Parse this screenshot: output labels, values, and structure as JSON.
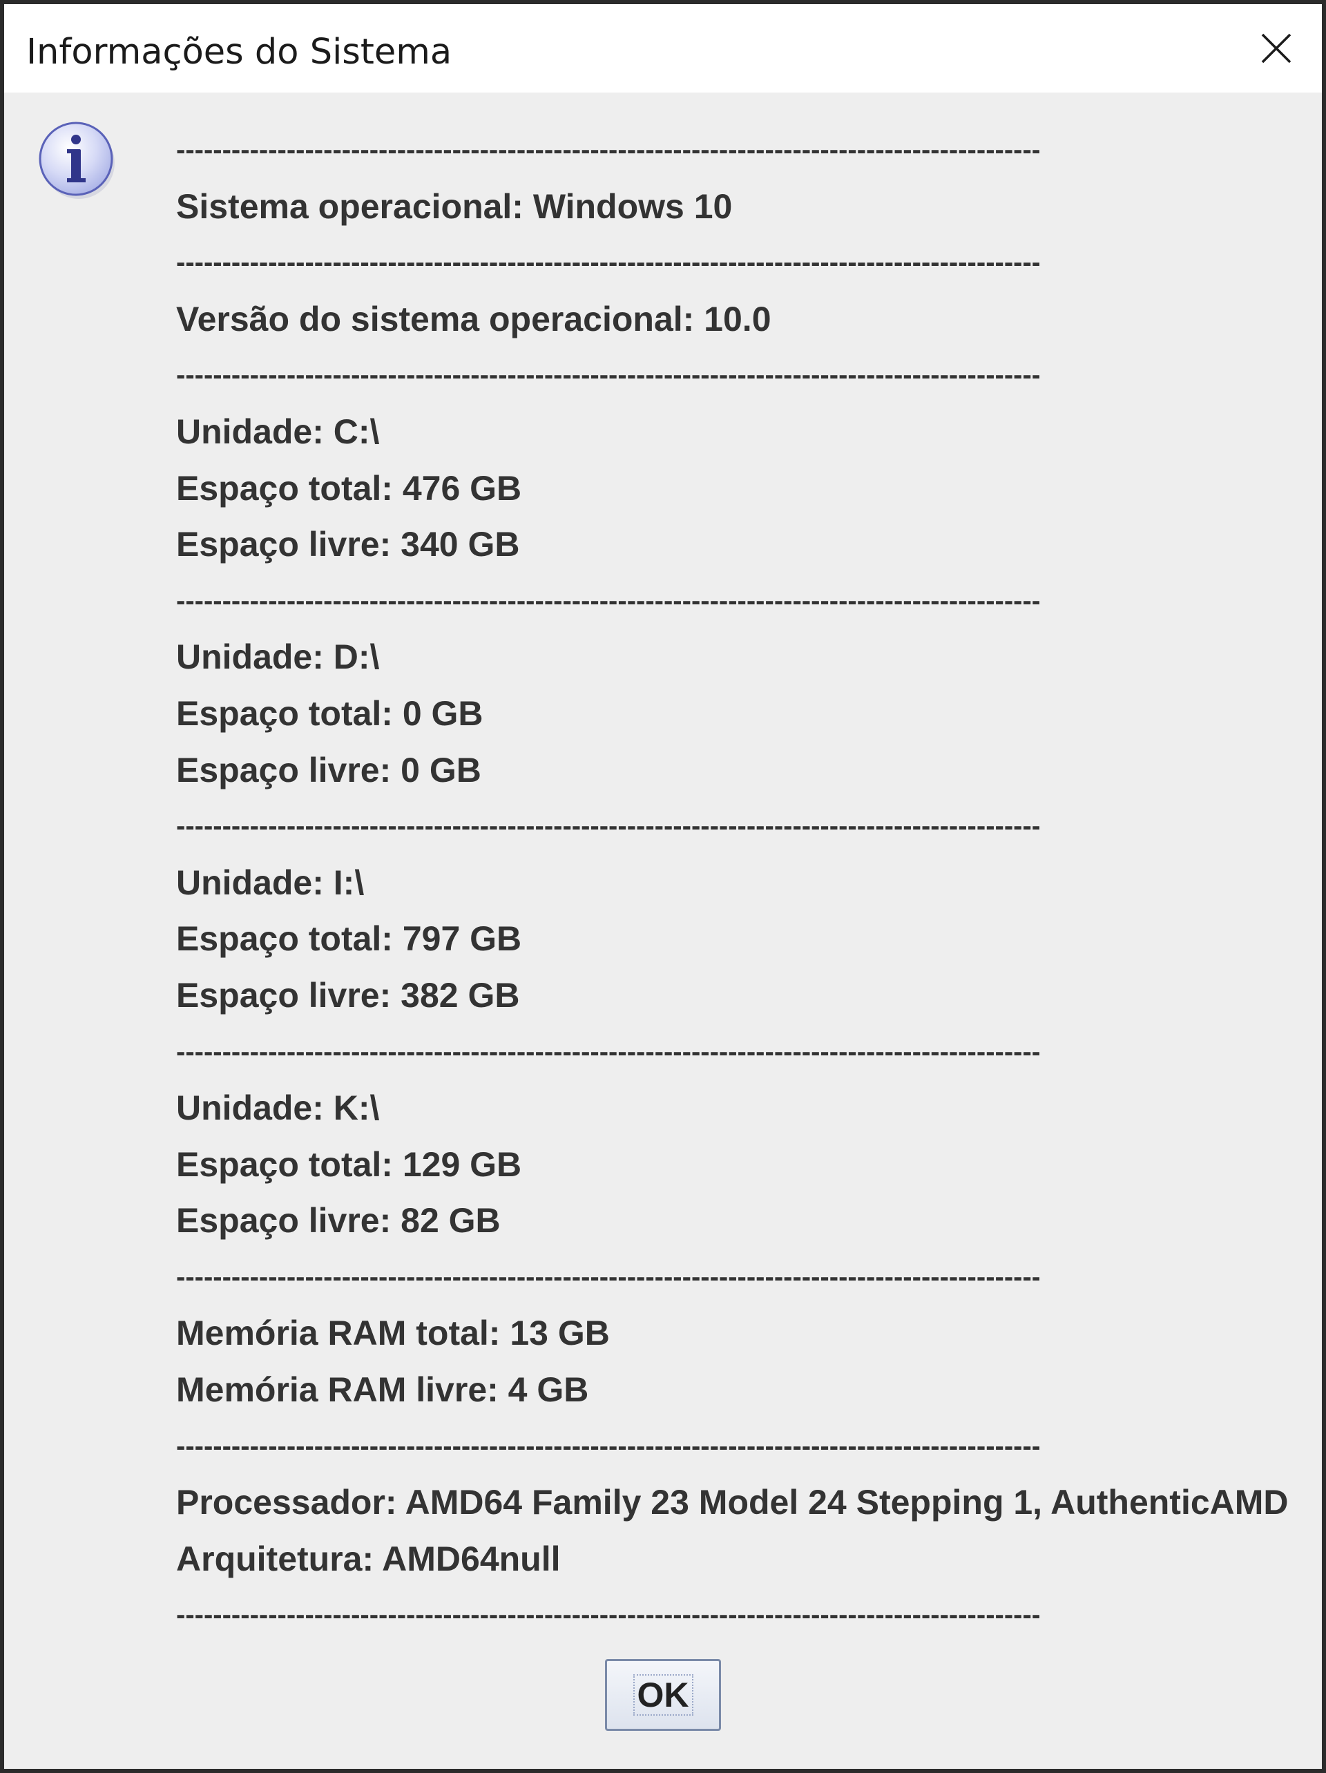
{
  "window": {
    "title": "Informações do Sistema"
  },
  "icons": {
    "info": "info-icon",
    "close": "close-icon"
  },
  "separator": "------------------------------------------------------------------------------------------------------------------------",
  "lines": [
    "Sistema operacional: Windows 10",
    "Versão do sistema operacional: 10.0",
    "Unidade: C:\\",
    "Espaço total: 476 GB",
    "Espaço livre: 340 GB",
    "Unidade: D:\\",
    "Espaço total: 0 GB",
    "Espaço livre: 0 GB",
    "Unidade: I:\\",
    "Espaço total: 797 GB",
    "Espaço livre: 382 GB",
    "Unidade: K:\\",
    "Espaço total: 129 GB",
    "Espaço livre: 82 GB",
    "Memória RAM total: 13 GB",
    "Memória RAM livre: 4 GB",
    "Processador: AMD64 Family 23 Model 24 Stepping 1, AuthenticAMD",
    "Arquitetura: AMD64null"
  ],
  "buttons": {
    "ok": "OK"
  }
}
